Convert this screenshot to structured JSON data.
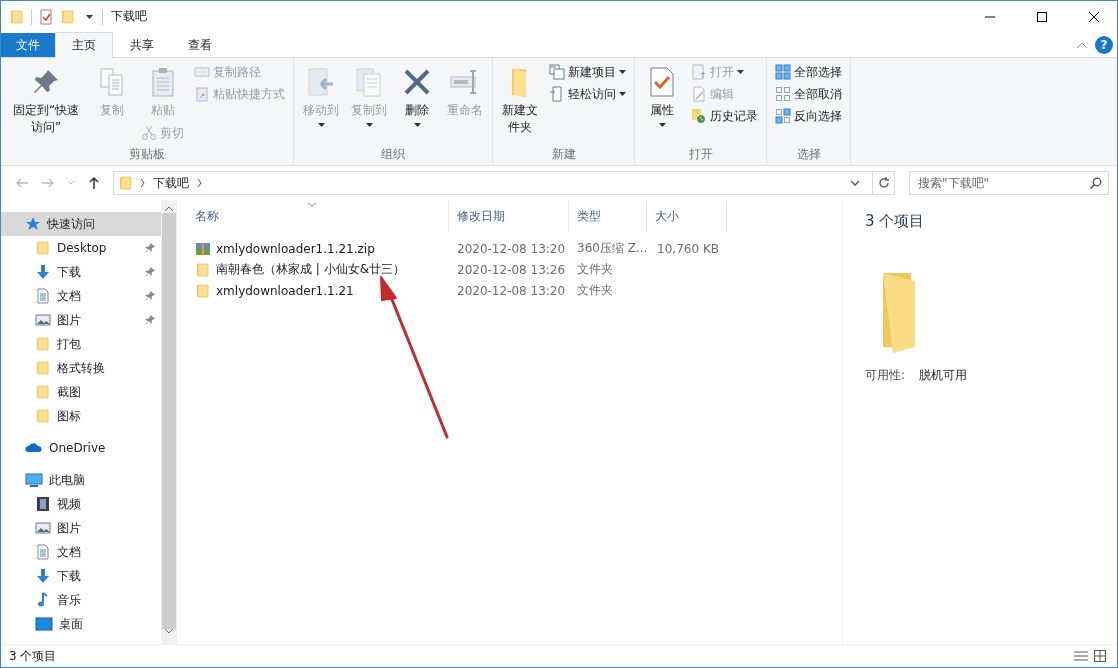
{
  "window": {
    "title": "下载吧"
  },
  "quick_toolbar": {
    "dropdown": true
  },
  "ribbon_tabs": [
    {
      "label": "文件",
      "kind": "file",
      "selected": false
    },
    {
      "label": "主页",
      "kind": "tab",
      "selected": true
    },
    {
      "label": "共享",
      "kind": "tab",
      "selected": false
    },
    {
      "label": "查看",
      "kind": "tab",
      "selected": false
    }
  ],
  "help": {
    "label": "?"
  },
  "ribbon_groups": [
    {
      "label": "剪贴板",
      "columns": [
        [
          {
            "label": "固定到“快速访问”",
            "kind": "pin",
            "large": true,
            "disabled": false,
            "dropdown": false
          }
        ],
        [
          {
            "label": "复制",
            "kind": "copy",
            "large": true,
            "disabled": true,
            "dropdown": false
          }
        ],
        [
          {
            "label": "粘贴",
            "kind": "paste",
            "large": true,
            "disabled": true,
            "dropdown": false
          },
          {
            "label": "剪切",
            "kind": "cut",
            "large": false,
            "disabled": true,
            "dropdown": false
          }
        ],
        [
          {
            "label": "复制路径",
            "kind": "copy_path",
            "large": false,
            "disabled": true,
            "dropdown": false
          },
          {
            "label": "粘贴快捷方式",
            "kind": "paste_shortcut",
            "large": false,
            "disabled": true,
            "dropdown": false
          }
        ]
      ]
    },
    {
      "label": "组织",
      "columns": [
        [
          {
            "label": "移动到",
            "kind": "move_to",
            "large": true,
            "disabled": true,
            "dropdown": true
          }
        ],
        [
          {
            "label": "复制到",
            "kind": "copy_to",
            "large": true,
            "disabled": true,
            "dropdown": true
          }
        ],
        [
          {
            "label": "删除",
            "kind": "delete",
            "large": true,
            "disabled": false,
            "dropdown": true
          }
        ],
        [
          {
            "label": "重命名",
            "kind": "rename",
            "large": true,
            "disabled": true,
            "dropdown": false
          }
        ]
      ]
    },
    {
      "label": "新建",
      "columns": [
        [
          {
            "label": "新建文件夹",
            "kind": "new_folder",
            "large": true,
            "disabled": false,
            "dropdown": false
          }
        ],
        [
          {
            "label": "新建项目",
            "kind": "new_item",
            "large": false,
            "disabled": false,
            "dropdown": true
          },
          {
            "label": "轻松访问",
            "kind": "easy_access",
            "large": false,
            "disabled": false,
            "dropdown": true
          }
        ]
      ]
    },
    {
      "label": "打开",
      "columns": [
        [
          {
            "label": "属性",
            "kind": "properties",
            "large": true,
            "disabled": false,
            "dropdown": true
          }
        ],
        [
          {
            "label": "打开",
            "kind": "open",
            "large": false,
            "disabled": true,
            "dropdown": true
          },
          {
            "label": "编辑",
            "kind": "edit",
            "large": false,
            "disabled": true,
            "dropdown": false
          },
          {
            "label": "历史记录",
            "kind": "history",
            "large": false,
            "disabled": false,
            "dropdown": false
          }
        ]
      ]
    },
    {
      "label": "选择",
      "columns": [
        [
          {
            "label": "全部选择",
            "kind": "select_all",
            "large": false,
            "disabled": false,
            "dropdown": false
          },
          {
            "label": "全部取消",
            "kind": "select_none",
            "large": false,
            "disabled": false,
            "dropdown": false
          },
          {
            "label": "反向选择",
            "kind": "invert_selection",
            "large": false,
            "disabled": false,
            "dropdown": false
          }
        ]
      ]
    }
  ],
  "address_bar": {
    "path": [
      "下载吧"
    ]
  },
  "search": {
    "placeholder": "搜索\"下载吧\""
  },
  "navigation": [
    {
      "label": "快速访问",
      "kind": "quick_access",
      "selected": true,
      "pinned": false,
      "children": [
        {
          "label": "Desktop",
          "kind": "folder",
          "selected": false,
          "pinned": true
        },
        {
          "label": "下载",
          "kind": "downloads",
          "selected": false,
          "pinned": true
        },
        {
          "label": "文档",
          "kind": "documents",
          "selected": false,
          "pinned": true
        },
        {
          "label": "图片",
          "kind": "pictures",
          "selected": false,
          "pinned": true
        },
        {
          "label": "打包",
          "kind": "folder",
          "selected": false,
          "pinned": false
        },
        {
          "label": "格式转换",
          "kind": "folder",
          "selected": false,
          "pinned": false
        },
        {
          "label": "截图",
          "kind": "folder",
          "selected": false,
          "pinned": false
        },
        {
          "label": "图标",
          "kind": "folder",
          "selected": false,
          "pinned": false
        }
      ]
    },
    {
      "label": "OneDrive",
      "kind": "onedrive",
      "selected": false,
      "pinned": false
    },
    {
      "label": "此电脑",
      "kind": "pc",
      "selected": false,
      "pinned": false,
      "children": [
        {
          "label": "视频",
          "kind": "videos",
          "selected": false,
          "pinned": false
        },
        {
          "label": "图片",
          "kind": "pictures",
          "selected": false,
          "pinned": false
        },
        {
          "label": "文档",
          "kind": "documents",
          "selected": false,
          "pinned": false
        },
        {
          "label": "下载",
          "kind": "downloads",
          "selected": false,
          "pinned": false
        },
        {
          "label": "音乐",
          "kind": "music",
          "selected": false,
          "pinned": false
        },
        {
          "label": "桌面",
          "kind": "desktop",
          "selected": false,
          "pinned": false
        }
      ]
    }
  ],
  "file_list": {
    "columns": [
      "名称",
      "修改日期",
      "类型",
      "大小"
    ],
    "rows": [
      {
        "kind": "zip",
        "name": "xmlydownloader1.1.21.zip",
        "modified": "2020-12-08 13:20",
        "type": "360压缩 Z...",
        "size": "10,760 KB"
      },
      {
        "kind": "folder",
        "name": "南朝春色（林家成 | 小仙女&廿三）",
        "modified": "2020-12-08 13:26",
        "type": "文件夹",
        "size": ""
      },
      {
        "kind": "folder",
        "name": "xmlydownloader1.1.21",
        "modified": "2020-12-08 13:20",
        "type": "文件夹",
        "size": ""
      }
    ]
  },
  "details_pane": {
    "heading": "3 个项目",
    "availability_label": "可用性:",
    "availability_value": "脱机可用"
  },
  "status_bar": {
    "item_count": "3 个项目"
  }
}
